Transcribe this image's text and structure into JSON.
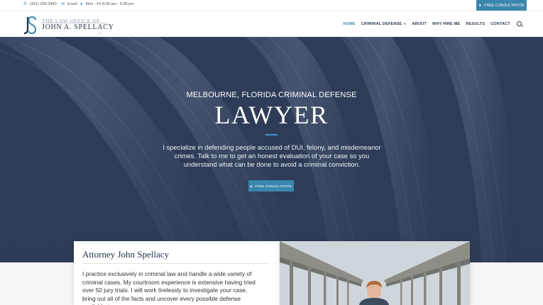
{
  "topbar": {
    "phone": "(321) 209-2440",
    "email": "Email",
    "hours": "Mon - Fri 8:00 am - 5:00 pm",
    "cta": "FREE CONSULTATION"
  },
  "logo": {
    "line1": "THE LAW OFFICE OF",
    "line2": "JOHN A. SPELLACY",
    "suffix": "P.A."
  },
  "nav": {
    "items": [
      "HOME",
      "CRIMINAL DEFENSE",
      "ABOUT",
      "WHY HIRE ME",
      "RESULTS",
      "CONTACT"
    ],
    "active": "HOME"
  },
  "hero": {
    "subtitle": "MELBOURNE, FLORIDA CRIMINAL DEFENSE",
    "title": "LAWYER",
    "text": "I specialize in defending people accused of DUI, felony, and misdemeanor crimes. Talk to me to get an honest evaluation of your case so you understand what can be done to avoid a criminal conviction.",
    "cta": "FREE CONSULTATION"
  },
  "bio": {
    "title": "Attorney John Spellacy",
    "text": "I practice exclusively in criminal law and handle a wide variety of criminal cases.  My courtroom experience is extensive having tried over 50 jury trials. I will work tirelessly to investigate your case, bring out all of the facts and uncover every possible defense available to"
  },
  "colors": {
    "accent": "#3a86ad",
    "navy": "#2a3a52",
    "hero_overlay": "#2e3b56"
  },
  "icons": [
    "phone-icon",
    "email-icon",
    "clock-icon",
    "chat-icon",
    "chevron-right-icon",
    "search-icon"
  ]
}
